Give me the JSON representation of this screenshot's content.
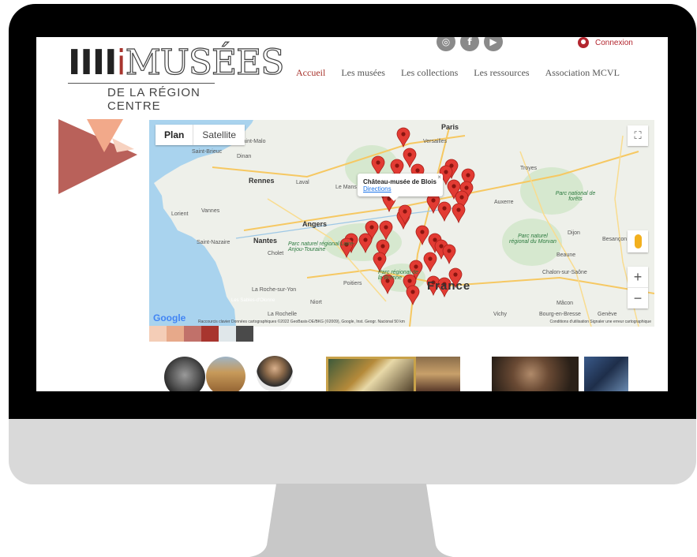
{
  "logo": {
    "bars": "IIII",
    "accent_letter": "i",
    "word": "MUSÉES",
    "subtitle": "DE LA RÉGION CENTRE"
  },
  "social": [
    {
      "name": "instagram-icon",
      "glyph": "◎"
    },
    {
      "name": "facebook-icon",
      "glyph": "f"
    },
    {
      "name": "youtube-icon",
      "glyph": "▶"
    }
  ],
  "login": {
    "label": "Connexion"
  },
  "nav": [
    {
      "label": "Accueil",
      "active": true
    },
    {
      "label": "Les musées",
      "active": false
    },
    {
      "label": "Les collections",
      "active": false
    },
    {
      "label": "Les ressources",
      "active": false
    },
    {
      "label": "Association MCVL",
      "active": false
    }
  ],
  "map": {
    "type_buttons": {
      "plan": "Plan",
      "satellite": "Satellite"
    },
    "fullscreen_icon": "⛶",
    "zoom_in": "+",
    "zoom_out": "−",
    "popup": {
      "title": "Château-musée de Blois",
      "link": "Directions",
      "close": "×"
    },
    "google_logo": "Google",
    "attribution_left": "Raccourcis clavier   Données cartographiques ©2022 GeoBasis-DE/BKG (©2009), Google, Inst. Geogr. Nacional   50 km",
    "attribution_right": "Conditions d'utilisation   Signaler une erreur cartographique",
    "labels": [
      {
        "text": "Paris",
        "kind": "big"
      },
      {
        "text": "Versailles",
        "kind": "normal"
      },
      {
        "text": "Saint-Malo",
        "kind": "normal"
      },
      {
        "text": "Saint-Brieuc",
        "kind": "normal"
      },
      {
        "text": "Dinan",
        "kind": "normal"
      },
      {
        "text": "Rennes",
        "kind": "normal"
      },
      {
        "text": "Laval",
        "kind": "normal"
      },
      {
        "text": "Le Mans",
        "kind": "normal"
      },
      {
        "text": "Troyes",
        "kind": "normal"
      },
      {
        "text": "Auxerre",
        "kind": "normal"
      },
      {
        "text": "Parc national de forêts",
        "kind": "park"
      },
      {
        "text": "Lorient",
        "kind": "normal"
      },
      {
        "text": "Vannes",
        "kind": "normal"
      },
      {
        "text": "Angers",
        "kind": "normal"
      },
      {
        "text": "Saint-Nazaire",
        "kind": "normal"
      },
      {
        "text": "Nantes",
        "kind": "big"
      },
      {
        "text": "Cholet",
        "kind": "normal"
      },
      {
        "text": "Parc naturel régional Loire-Anjou-Touraine",
        "kind": "park"
      },
      {
        "text": "Parc naturel régional du Morvan",
        "kind": "park"
      },
      {
        "text": "Dijon",
        "kind": "normal"
      },
      {
        "text": "Besançon",
        "kind": "normal"
      },
      {
        "text": "Beaune",
        "kind": "normal"
      },
      {
        "text": "Chalon-sur-Saône",
        "kind": "normal"
      },
      {
        "text": "Poitiers",
        "kind": "normal"
      },
      {
        "text": "La Roche-sur-Yon",
        "kind": "normal"
      },
      {
        "text": "Niort",
        "kind": "normal"
      },
      {
        "text": "La Rochelle",
        "kind": "normal"
      },
      {
        "text": "Les Sables-d'Olonne",
        "kind": "normal"
      },
      {
        "text": "Mâcon",
        "kind": "normal"
      },
      {
        "text": "Vichy",
        "kind": "normal"
      },
      {
        "text": "Bourg-en-Bresse",
        "kind": "normal"
      },
      {
        "text": "Genève",
        "kind": "normal"
      },
      {
        "text": "France",
        "kind": "france"
      },
      {
        "text": "Parc régional de la Brenne",
        "kind": "park"
      }
    ]
  },
  "palette": [
    "#f4cdb7",
    "#e7a98a",
    "#c1716a",
    "#a8352e",
    "#e0e7ea",
    "#4a4a4a"
  ]
}
